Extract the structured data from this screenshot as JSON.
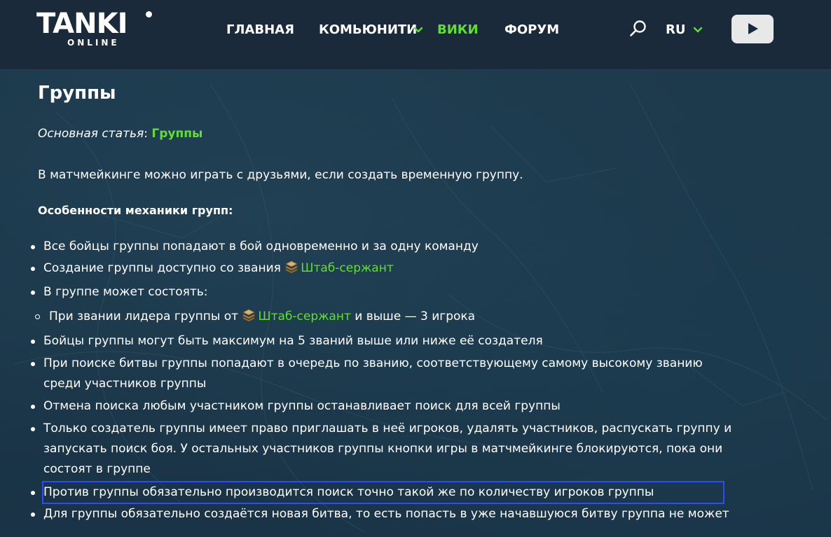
{
  "header": {
    "logo_main": "TANKI",
    "logo_sub": "ONLINE",
    "nav": [
      {
        "label": "ГЛАВНАЯ"
      },
      {
        "label": "КОМЬЮНИТИ"
      },
      {
        "label": "ВИКИ"
      },
      {
        "label": "ФОРУМ"
      }
    ],
    "language": "RU",
    "icons": {
      "search": "search-icon",
      "lang_dropdown": "chevron-down-icon",
      "community_dropdown": "chevron-down-icon",
      "youtube": "youtube-play-icon"
    },
    "colors": {
      "accent": "#5fe02e",
      "header_bg": "#1a2a3b"
    }
  },
  "article": {
    "title": "Группы",
    "main_article_label": "Основная статья",
    "main_article_sep": ":",
    "main_article_link": "Группы",
    "intro": "В матчмейкинге можно играть с друзьями, если создать временную группу.",
    "subhead": "Особенности механики групп:",
    "items": [
      {
        "text": "Все бойцы группы попадают в бой одновременно и за одну команду"
      },
      {
        "text_before": "Создание группы доступно со звания",
        "rank": "Штаб-сержант"
      },
      {
        "text": "В группе может состоять:"
      },
      {
        "text_before": "При звании лидера группы от",
        "rank": "Штаб-сержант",
        "text_after": "и выше — 3 игрока"
      },
      {
        "text": "Бойцы группы могут быть максимум на 5 званий выше или ниже её создателя"
      },
      {
        "line1": "При поиске битвы группы попадают в очередь по званию, соответствующему самому высокому званию",
        "line2": "среди участников группы"
      },
      {
        "text": "Отмена поиска любым участником группы останавливает поиск для всей группы"
      },
      {
        "line1": "Только создатель группы имеет право приглашать в неё игроков, удалять участников, распускать группу и",
        "line2": "запускать поиск боя. У остальных участников группы кнопки игры в матчмейкинге блокируются, пока они",
        "line3": "состоят в группе"
      },
      {
        "text": "Против группы обязательно производится поиск точно такой же по количеству игроков группы"
      },
      {
        "text": "Для группы обязательно создаётся новая битва, то есть попасть в уже начавшуюся битву группа не может"
      }
    ],
    "rank_icon": "staff-sergeant-rank-icon",
    "highlight_color": "#2a4cff"
  }
}
